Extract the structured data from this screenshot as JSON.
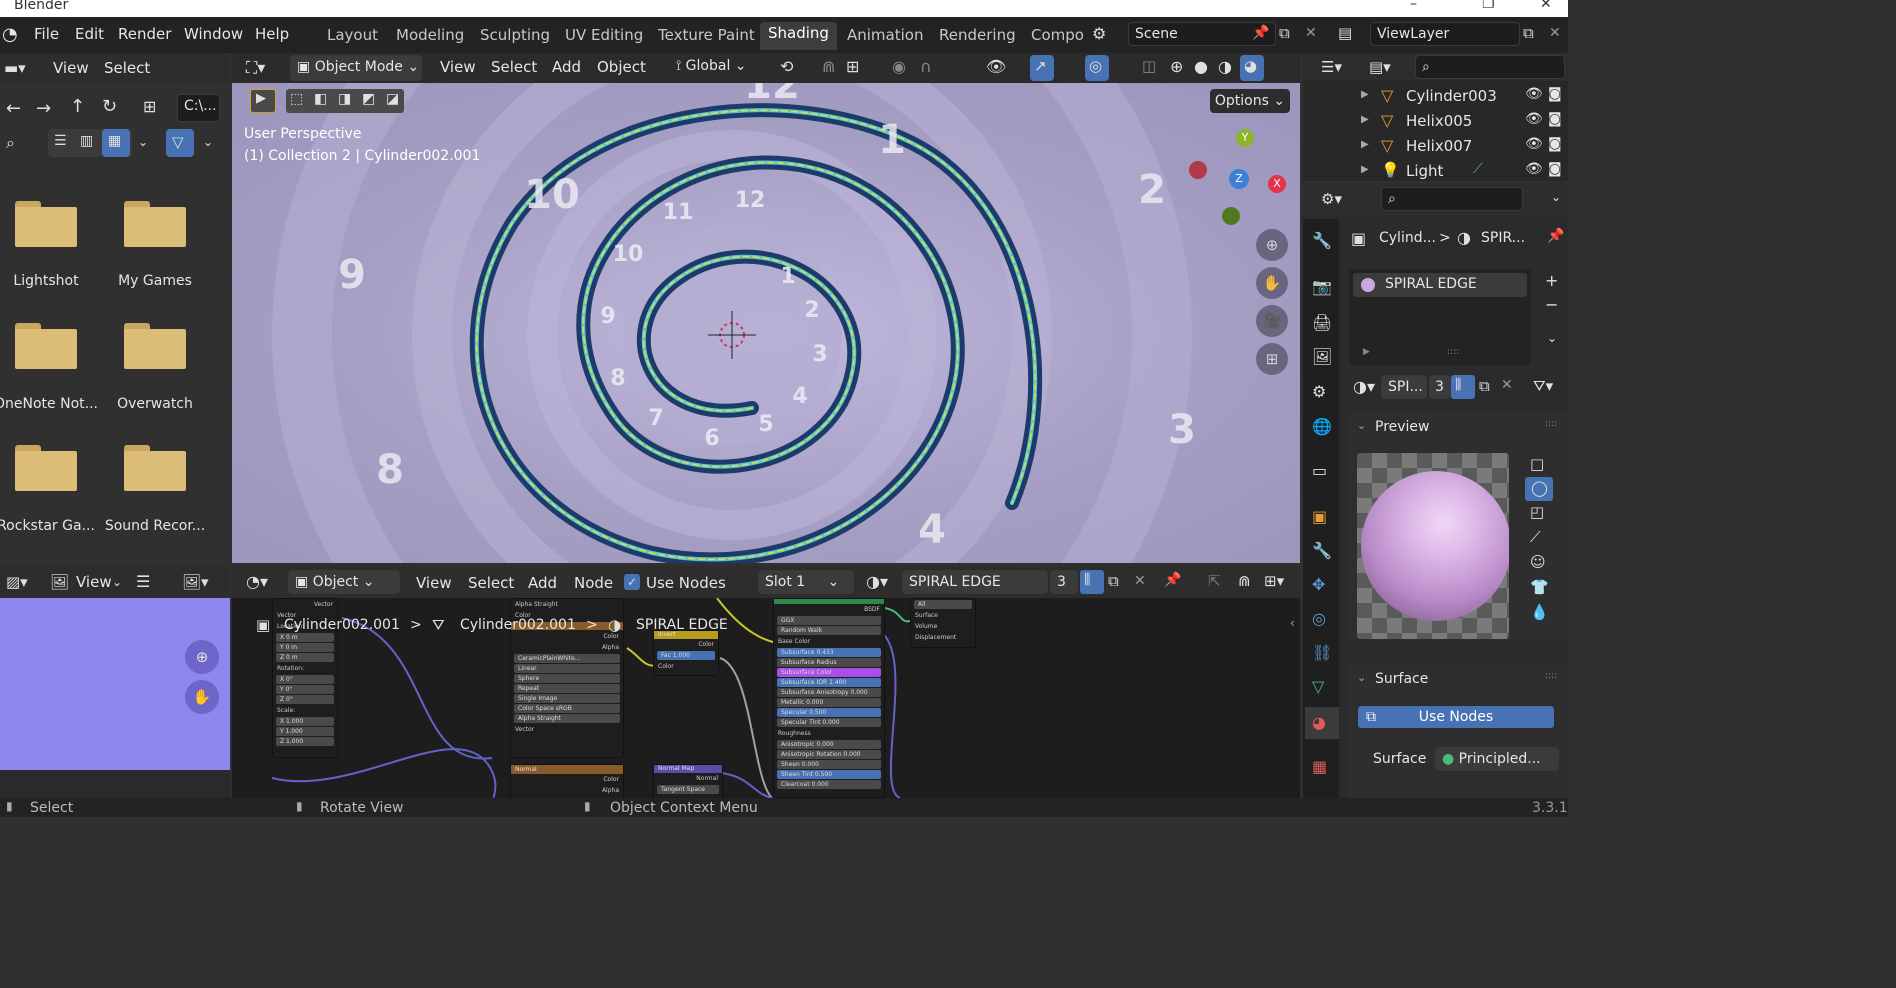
{
  "window": {
    "title": "Blender"
  },
  "menu": [
    "File",
    "Edit",
    "Render",
    "Window",
    "Help"
  ],
  "workspaces": [
    {
      "label": "Layout",
      "active": false
    },
    {
      "label": "Modeling",
      "active": false
    },
    {
      "label": "Sculpting",
      "active": false
    },
    {
      "label": "UV Editing",
      "active": false
    },
    {
      "label": "Texture Paint",
      "active": false
    },
    {
      "label": "Shading",
      "active": true
    },
    {
      "label": "Animation",
      "active": false
    },
    {
      "label": "Rendering",
      "active": false
    },
    {
      "label": "Compo",
      "active": false
    }
  ],
  "scene": {
    "label": "Scene"
  },
  "viewlayer": {
    "label": "ViewLayer"
  },
  "file_browser": {
    "view_label": "View",
    "select_label": "Select",
    "path": "C:\\...",
    "folders": [
      "Lightshot",
      "My Games",
      "OneNote Not...",
      "Overwatch",
      "Rockstar Ga...",
      "Sound Recor..."
    ]
  },
  "viewport": {
    "mode": "Object Mode",
    "menus": [
      "View",
      "Select",
      "Add",
      "Object"
    ],
    "transform": "Global",
    "options": "Options",
    "perspective": "User Perspective",
    "collection": "(1) Collection 2 | Cylinder002.001",
    "gizmo": {
      "x": "X",
      "y": "Y",
      "z": "Z"
    },
    "clock_numbers": [
      "1",
      "2",
      "3",
      "4",
      "5",
      "6",
      "7",
      "8",
      "9",
      "10",
      "11",
      "12"
    ]
  },
  "outliner": {
    "items": [
      {
        "label": "Cylinder003",
        "icon": "mesh-icon"
      },
      {
        "label": "Helix005",
        "icon": "mesh-icon"
      },
      {
        "label": "Helix007",
        "icon": "mesh-icon"
      },
      {
        "label": "Light",
        "icon": "light-icon"
      }
    ]
  },
  "properties": {
    "breadcrumb_obj": "Cylind...",
    "breadcrumb_mat": "SPIR...",
    "material_slot": "SPIRAL EDGE",
    "mat_short": "SPI...",
    "mat_users": "3",
    "preview_label": "Preview",
    "surface_label": "Surface",
    "use_nodes": "Use Nodes",
    "surface_field_label": "Surface",
    "surface_value": "Principled..."
  },
  "image_editor": {
    "view_label": "View"
  },
  "node_editor": {
    "type": "Object",
    "menus": [
      "View",
      "Select",
      "Add",
      "Node"
    ],
    "use_nodes": "Use Nodes",
    "slot": "Slot 1",
    "material": "SPIRAL EDGE",
    "users": "3",
    "breadcrumb": [
      "Cylinder002.001",
      "Cylinder002.001",
      "SPIRAL EDGE"
    ]
  },
  "status": {
    "select": "Select",
    "rotate": "Rotate View",
    "context": "Object Context Menu",
    "version": "3.3.1"
  },
  "colors": {
    "accent": "#4772b3",
    "viewport_bg": "#a8a2c6",
    "folder": "#dcbd78"
  }
}
